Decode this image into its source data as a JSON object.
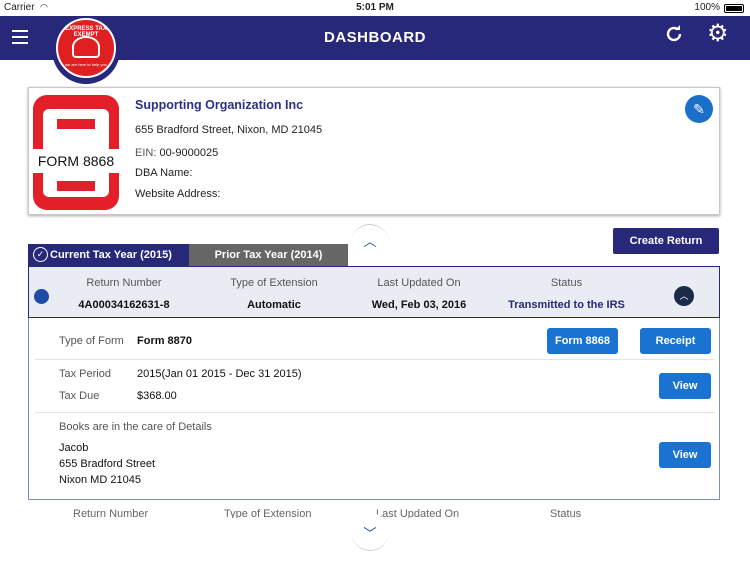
{
  "status_bar": {
    "carrier": "Carrier",
    "time": "5:01 PM",
    "battery": "100%"
  },
  "navbar": {
    "title": "DASHBOARD"
  },
  "logo": {
    "ring_text": "EXPRESS TAX EXEMPT",
    "tagline": "we are here to help you"
  },
  "organization": {
    "form_label": "FORM 8868",
    "name": "Supporting Organization Inc",
    "address": "655 Bradford Street, Nixon, MD 21045",
    "ein_label": "EIN:",
    "ein": "00-9000025",
    "dba_label": "DBA Name:",
    "website_label": "Website Address:"
  },
  "tabs": [
    {
      "label": "Current Tax Year (2015)",
      "active": true
    },
    {
      "label": "Prior Tax Year (2014)",
      "active": false
    }
  ],
  "create_return_label": "Create Return",
  "returns_table": {
    "headers": [
      "Return Number",
      "Type of Extension",
      "Last Updated On",
      "Status"
    ],
    "row": {
      "return_number": "4A00034162631-8",
      "type_of_extension": "Automatic",
      "last_updated_on": "Wed, Feb 03, 2016",
      "status": "Transmitted to the IRS"
    }
  },
  "details": {
    "type_of_form_label": "Type of Form",
    "type_of_form": "Form 8870",
    "form_button": "Form 8868",
    "receipt_button": "Receipt",
    "tax_period_label": "Tax Period",
    "tax_period": "2015(Jan 01 2015 - Dec 31 2015)",
    "tax_due_label": "Tax Due",
    "tax_due": "$368.00",
    "view_button": "View",
    "books_label": "Books are in the care of Details",
    "books_name": "Jacob",
    "books_street": "655 Bradford Street",
    "books_city": "Nixon MD 21045"
  },
  "icons": [
    "menu-icon",
    "refresh-icon",
    "gear-icon",
    "pencil-icon",
    "chevron-up-icon",
    "chevron-down-icon",
    "check-circle-icon"
  ],
  "colors": {
    "brand_navy": "#27287a",
    "action_blue": "#1a73d1",
    "logo_red": "#e02020"
  }
}
